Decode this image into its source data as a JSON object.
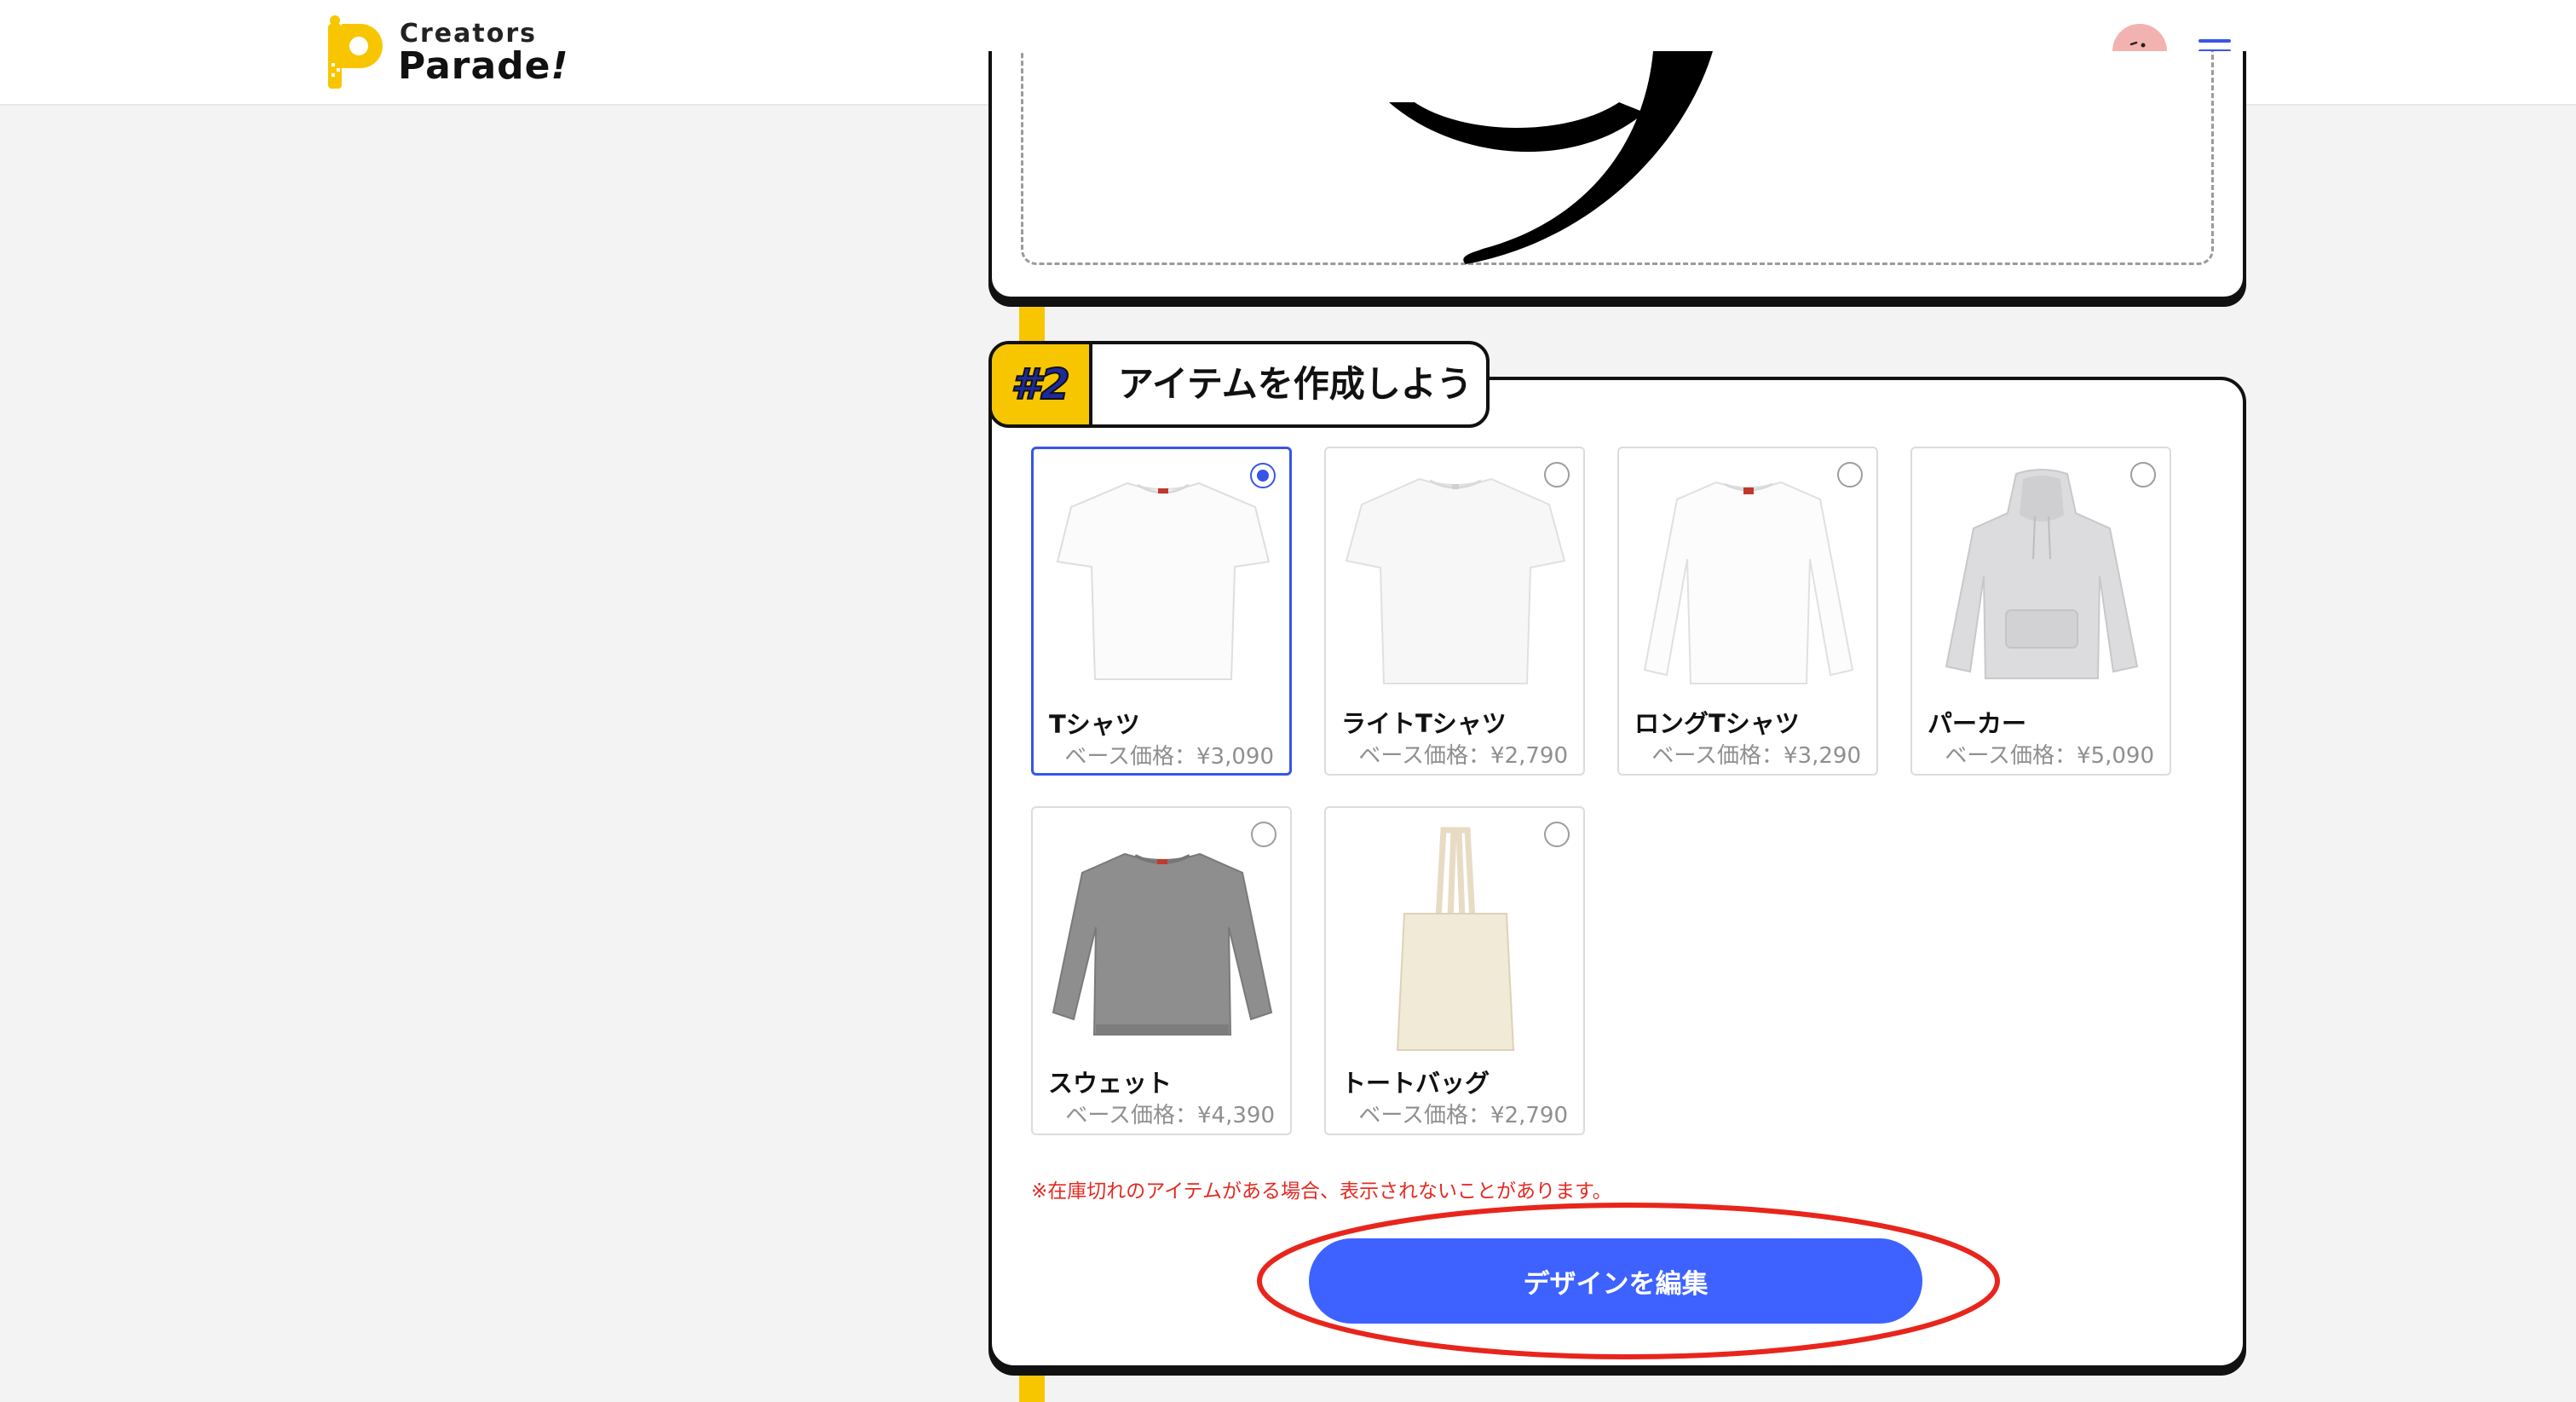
{
  "header": {
    "logo_top": "Creators",
    "logo_bottom": "Parade",
    "logo_bang": "!",
    "avatar_icon": "tongue-face-avatar",
    "menu_icon": "hamburger-menu-icon"
  },
  "section2": {
    "step_number": "#2",
    "title": "アイテムを作成しよう"
  },
  "items": [
    {
      "name": "Tシャツ",
      "price": "ベース価格：¥3,090",
      "selected": true
    },
    {
      "name": "ライトTシャツ",
      "price": "ベース価格：¥2,790",
      "selected": false
    },
    {
      "name": "ロングTシャツ",
      "price": "ベース価格：¥3,290",
      "selected": false
    },
    {
      "name": "パーカー",
      "price": "ベース価格：¥5,090",
      "selected": false
    },
    {
      "name": "スウェット",
      "price": "ベース価格：¥4,390",
      "selected": false
    },
    {
      "name": "トートバッグ",
      "price": "ベース価格：¥2,790",
      "selected": false
    }
  ],
  "note": "※在庫切れのアイテムがある場合、表示されないことがあります。",
  "edit_button_label": "デザインを編集",
  "colors": {
    "accent_blue": "#3e62ff",
    "brand_yellow": "#f8c600",
    "note_red": "#e32a22",
    "highlight_red": "#e8251c"
  }
}
